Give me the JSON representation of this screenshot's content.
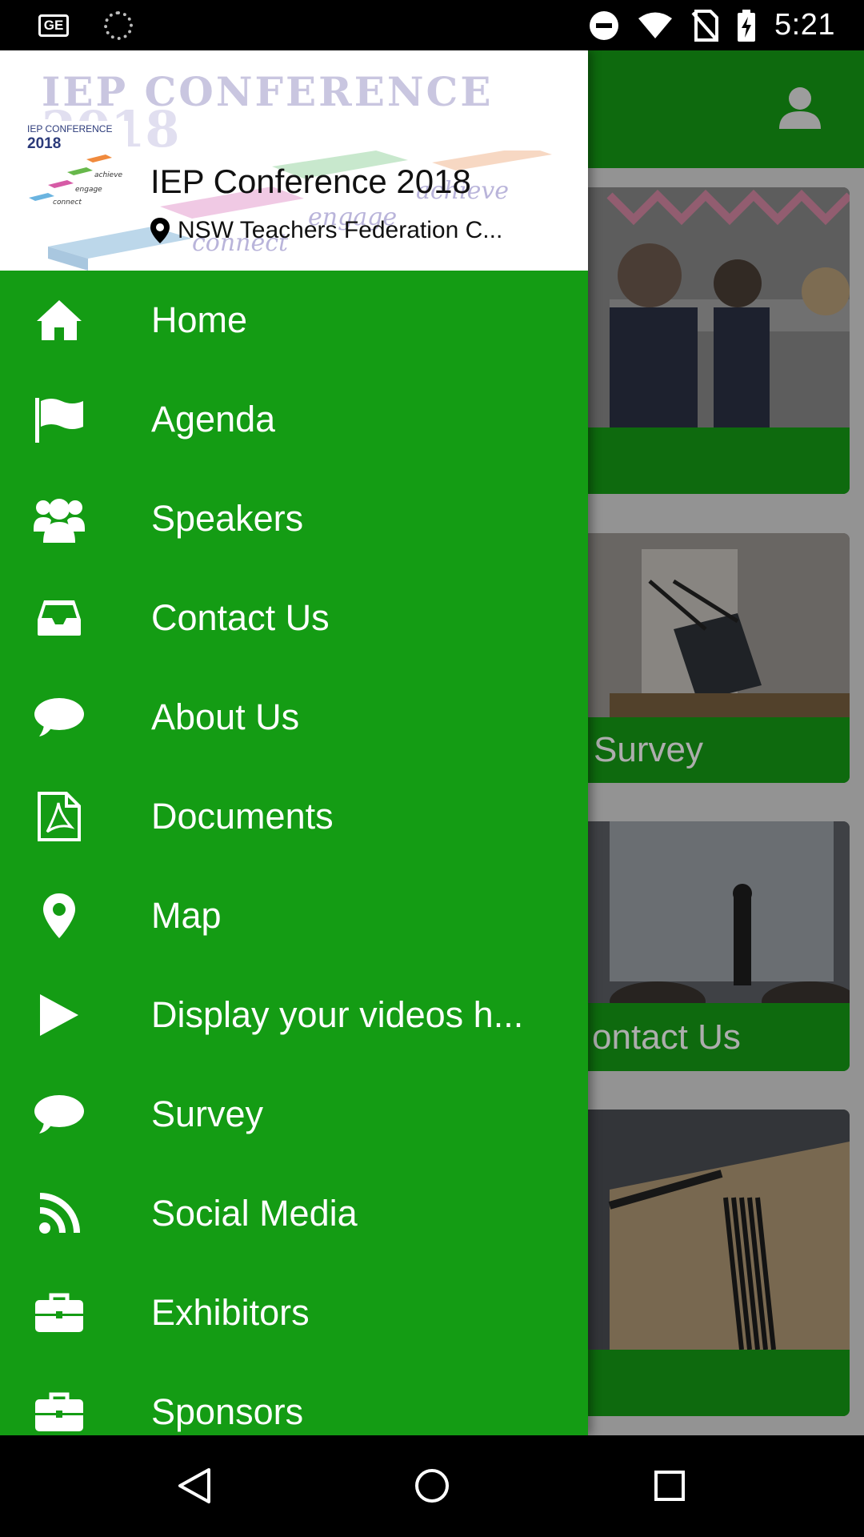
{
  "status_bar": {
    "left_icons": [
      "ge-icon",
      "spinner-icon"
    ],
    "ge_label": "GE",
    "right_icons": [
      "do-not-disturb-icon",
      "wifi-icon",
      "no-sim-icon",
      "battery-charging-icon"
    ],
    "time": "5:21"
  },
  "header": {
    "title": "IEP Conference 2018",
    "location": "NSW Teachers Federation C...",
    "logo": {
      "bg_title": "IEP CONFERENCE",
      "bg_year": "2018",
      "small_title": "IEP CONFERENCE",
      "small_year": "2018",
      "words": [
        "achieve",
        "engage",
        "connect"
      ]
    }
  },
  "menu": [
    {
      "label": "Home",
      "icon": "home-icon"
    },
    {
      "label": "Agenda",
      "icon": "flag-icon"
    },
    {
      "label": "Speakers",
      "icon": "users-icon"
    },
    {
      "label": "Contact Us",
      "icon": "inbox-icon"
    },
    {
      "label": "About Us",
      "icon": "chat-icon"
    },
    {
      "label": "Documents",
      "icon": "pdf-icon"
    },
    {
      "label": "Map",
      "icon": "map-pin-icon"
    },
    {
      "label": "Display your videos h...",
      "icon": "play-icon"
    },
    {
      "label": "Survey",
      "icon": "chat-icon"
    },
    {
      "label": "Social Media",
      "icon": "rss-icon"
    },
    {
      "label": "Exhibitors",
      "icon": "briefcase-icon"
    },
    {
      "label": "Sponsors",
      "icon": "briefcase-icon"
    }
  ],
  "background": {
    "cards": [
      {
        "caption": ""
      },
      {
        "caption": "Survey"
      },
      {
        "caption": "ontact Us"
      },
      {
        "caption": ""
      }
    ]
  },
  "colors": {
    "drawer_green": "#149c14",
    "toolbar_green": "#169c16",
    "header_bg": "#ffffff"
  },
  "nav_bar": [
    "back-icon",
    "home-circle-icon",
    "recents-icon"
  ]
}
